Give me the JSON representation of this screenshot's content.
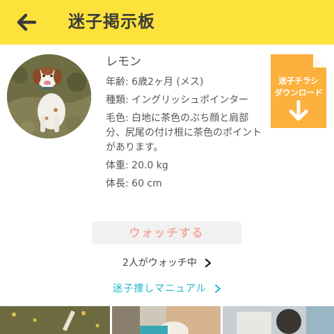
{
  "header": {
    "title": "迷子掲示板",
    "back_icon": "back-arrow-icon",
    "background": "#fde23b"
  },
  "pet": {
    "name": "レモン",
    "age": "年齢: 6歳2ヶ月 (メス)",
    "breed": "種類: イングリッシュポインター",
    "coat": "毛色: 白地に茶色のぶち顔と肩部分、尻尾の付け根に茶色のポイントがあります。",
    "weight": "体重: 20.0 kg",
    "length": "体長: 60 cm"
  },
  "flyer": {
    "label": "迷子チラシダウンロード",
    "label_line1": "迷子チラシ",
    "label_line2": "ダウンロード",
    "icon": "download-arrow-icon",
    "color": "#fbb13c"
  },
  "watch": {
    "button_label": "ウォッチする",
    "watchers_text": "2人がウォッチ中",
    "text_color": "#f4a89e"
  },
  "manual": {
    "link_text": "迷子捜しマニュアル",
    "color": "#1fb5d0"
  }
}
